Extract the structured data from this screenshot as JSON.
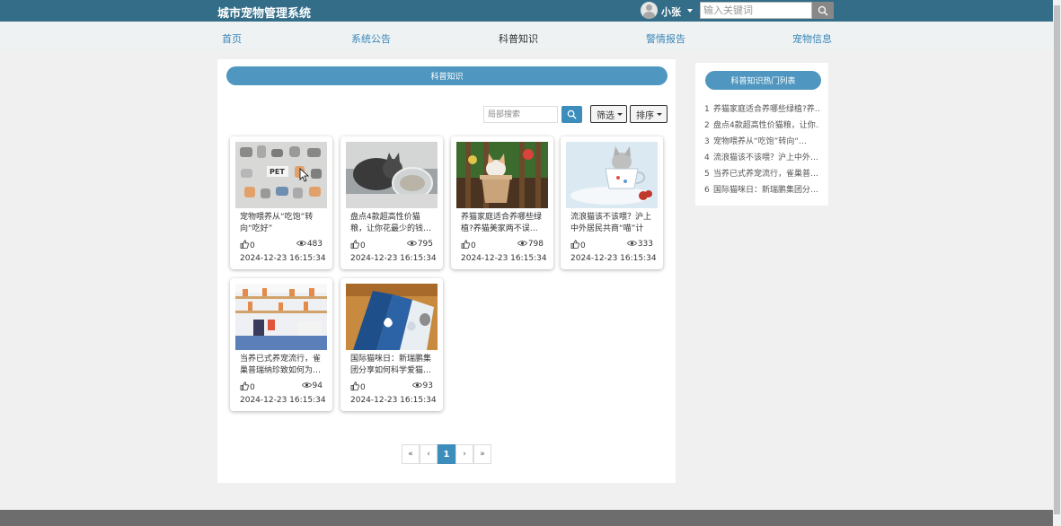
{
  "header": {
    "title": "城市宠物管理系统",
    "username": "小张",
    "search_placeholder": "输入关键词"
  },
  "nav": [
    {
      "label": "首页"
    },
    {
      "label": "系统公告"
    },
    {
      "label": "科普知识",
      "active": true
    },
    {
      "label": "警情报告"
    },
    {
      "label": "宠物信息"
    }
  ],
  "main": {
    "section_title": "科普知识",
    "local_search_placeholder": "局部搜索",
    "filter_label": "筛选",
    "sort_label": "排序",
    "cards": [
      {
        "title": "宠物喂养从“吃饱”转向“吃好”",
        "likes": "0",
        "views": "483",
        "date": "2024-12-23 16:15:34",
        "image": "pet-illustration-image"
      },
      {
        "title": "盘点4款超高性价猫粮，让你花最少的钱…",
        "likes": "0",
        "views": "795",
        "date": "2024-12-23 16:15:34",
        "image": "cat-eating-image"
      },
      {
        "title": "养猫家庭适合养哪些绿植?养猫美家两不误…",
        "likes": "0",
        "views": "798",
        "date": "2024-12-23 16:15:34",
        "image": "kitten-in-pot-image"
      },
      {
        "title": "流浪猫该不该喂？沪上中外居民共商“喵”计",
        "likes": "0",
        "views": "333",
        "date": "2024-12-23 16:15:34",
        "image": "kitten-in-teacup-image"
      },
      {
        "title": "当养已式养宠流行，雀巢普瑞纳珍致如何为…",
        "likes": "0",
        "views": "94",
        "date": "2024-12-23 16:15:34",
        "image": "pet-store-image"
      },
      {
        "title": "国际猫咪日：新瑞鹏集团分享如何科学爱猫…",
        "likes": "0",
        "views": "93",
        "date": "2024-12-23 16:15:34",
        "image": "cat-food-boxes-image"
      }
    ],
    "pagination": {
      "first": "«",
      "prev": "‹",
      "current": "1",
      "next": "›",
      "last": "»"
    }
  },
  "sidebar": {
    "title": "科普知识热门列表",
    "items": [
      {
        "num": "1",
        "text": "养猫家庭适合养哪些绿植?养…"
      },
      {
        "num": "2",
        "text": "盘点4款超高性价猫粮，让你…"
      },
      {
        "num": "3",
        "text": "宠物喂养从“吃饱”转向“…"
      },
      {
        "num": "4",
        "text": "流浪猫该不该喂？沪上中外…"
      },
      {
        "num": "5",
        "text": "当养已式养宠流行，雀巢普…"
      },
      {
        "num": "6",
        "text": "国际猫咪日：新瑞鹏集团分…"
      }
    ]
  },
  "colors": {
    "header_bg": "#336d88",
    "accent": "#3c8dbc",
    "pill": "#4f97c0"
  }
}
